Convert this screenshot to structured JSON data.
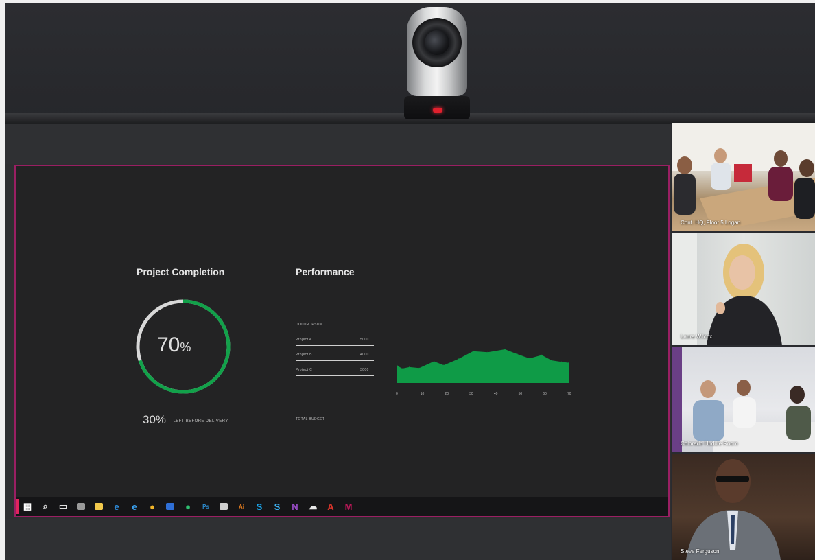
{
  "presentation": {
    "project_completion": {
      "title": "Project Completion",
      "completion_value": "70",
      "completion_unit": "%",
      "completion_fraction": 0.7,
      "remaining_value": "30%",
      "remaining_label": "LEFT BEFORE DELIVERY"
    },
    "performance": {
      "title": "Performance",
      "table_header": "DOLOR IPSUM",
      "rows": [
        {
          "name": "Project A",
          "value": "5000"
        },
        {
          "name": "Project B",
          "value": "4000"
        },
        {
          "name": "Project C",
          "value": "3000"
        }
      ],
      "footer_label": "TOTAL BUDGET"
    }
  },
  "chart_data": {
    "type": "area",
    "x_ticks": [
      "0",
      "10",
      "20",
      "30",
      "40",
      "50",
      "60",
      "70"
    ],
    "x": [
      0,
      2,
      5,
      9,
      15,
      19,
      25,
      31,
      37,
      44,
      49,
      54,
      59,
      63,
      67,
      70
    ],
    "values": [
      36,
      30,
      33,
      31,
      45,
      37,
      50,
      66,
      64,
      70,
      60,
      51,
      58,
      47,
      44,
      42
    ],
    "color": "#0f9b47",
    "grid": false,
    "legend": "none"
  },
  "taskbar": {
    "icons": [
      {
        "name": "windows-start-icon",
        "glyph": "▦",
        "color": "#ffffff"
      },
      {
        "name": "search-icon",
        "glyph": "⌕",
        "color": "#dddddd"
      },
      {
        "name": "task-view-icon",
        "glyph": "▭",
        "color": "#dddddd"
      },
      {
        "name": "calculator-icon",
        "glyph": "",
        "color": "#9a9a9a"
      },
      {
        "name": "file-explorer-icon",
        "glyph": "",
        "color": "#f2c94c"
      },
      {
        "name": "edge-icon",
        "glyph": "e",
        "color": "#2f8fe0"
      },
      {
        "name": "internet-explorer-icon",
        "glyph": "e",
        "color": "#3aa0ee"
      },
      {
        "name": "chrome-icon",
        "glyph": "●",
        "color": "#f0b429"
      },
      {
        "name": "teams-video-icon",
        "glyph": "",
        "color": "#2f6fd6"
      },
      {
        "name": "chat-icon",
        "glyph": "●",
        "color": "#2fbf71"
      },
      {
        "name": "photoshop-icon",
        "glyph": "Ps",
        "color": "#2d8ccf"
      },
      {
        "name": "paint-icon",
        "glyph": "",
        "color": "#d0d0d0"
      },
      {
        "name": "illustrator-icon",
        "glyph": "Ai",
        "color": "#e07a1f"
      },
      {
        "name": "skype-icon",
        "glyph": "S",
        "color": "#1aa3e8"
      },
      {
        "name": "skype-business-icon",
        "glyph": "S",
        "color": "#3cb0f0"
      },
      {
        "name": "onenote-icon",
        "glyph": "N",
        "color": "#9b4dca"
      },
      {
        "name": "onedrive-icon",
        "glyph": "☁",
        "color": "#e8e8e8"
      },
      {
        "name": "acrobat-icon",
        "glyph": "A",
        "color": "#d9352b"
      },
      {
        "name": "app-icon",
        "glyph": "M",
        "color": "#c2185b"
      }
    ]
  },
  "participants": [
    {
      "label": "Conf. HQ, Floor 5 Logan"
    },
    {
      "label": "Laura Wilcox"
    },
    {
      "label": "Colorado Huddle Room"
    },
    {
      "label": "Steve Ferguson"
    }
  ]
}
